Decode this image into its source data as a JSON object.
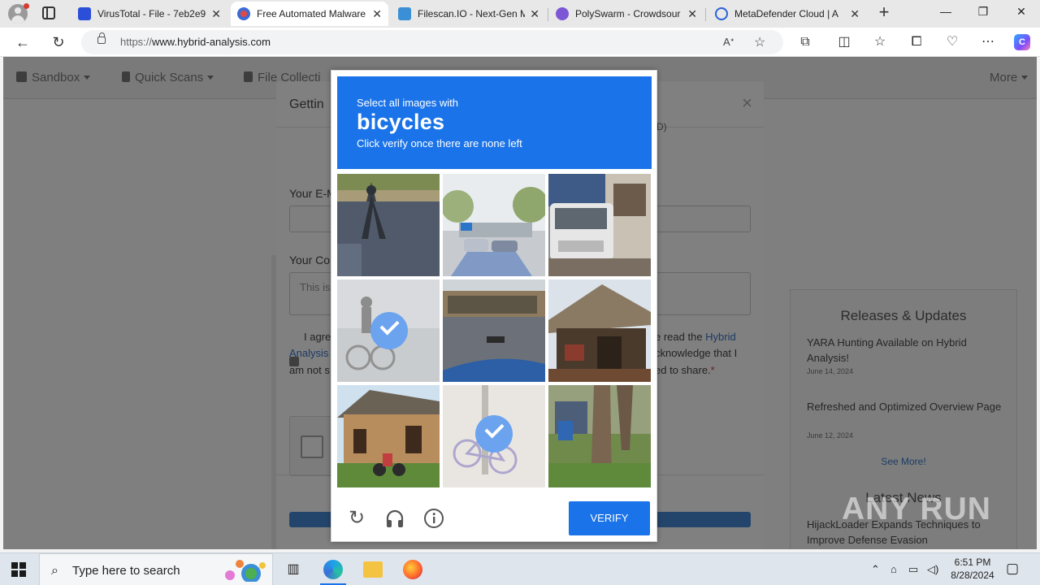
{
  "browser": {
    "tabs": [
      {
        "title": "VirusTotal - File - 7eb2e9",
        "active": false,
        "favicon": "virustotal-icon"
      },
      {
        "title": "Free Automated Malware",
        "active": true,
        "favicon": "hybrid-analysis-icon"
      },
      {
        "title": "Filescan.IO - Next-Gen M",
        "active": false,
        "favicon": "filescan-icon"
      },
      {
        "title": "PolySwarm - Crowdsour",
        "active": false,
        "favicon": "polyswarm-icon"
      },
      {
        "title": "MetaDefender Cloud | A",
        "active": false,
        "favicon": "metadefender-icon"
      }
    ],
    "url": {
      "protocol": "https://",
      "host": "www.hybrid-analysis.com"
    },
    "window_controls": [
      "minimize",
      "restore",
      "close"
    ]
  },
  "site_nav": {
    "items": [
      {
        "label": "Sandbox",
        "icon": "cube-icon"
      },
      {
        "label": "Quick Scans",
        "icon": "file-icon"
      },
      {
        "label": "File Collecti",
        "icon": "copy-icon"
      }
    ],
    "more": "More"
  },
  "modal": {
    "title": "Gettin",
    "email_label": "Your E-M",
    "comment_label": "Your Co",
    "comment_placeholder": "This is",
    "hint_tail": "(D)",
    "consent_left": [
      "I agre",
      "Analysis",
      "am not s"
    ],
    "consent_right": [
      "e read the ",
      "cknowledge that I",
      "ed to share."
    ],
    "consent_link": "Hybrid",
    "required_mark": "*"
  },
  "captcha": {
    "prompt": "Select all images with",
    "object": "bicycles",
    "instruction": "Click verify once there are none left",
    "tiles": [
      {
        "subject": "shadow-on-pavement",
        "selected": false
      },
      {
        "subject": "parking-lot-with-cars",
        "selected": false
      },
      {
        "subject": "white-truck",
        "selected": false
      },
      {
        "subject": "cyclist-on-road",
        "selected": true
      },
      {
        "subject": "blue-car-hood",
        "selected": false
      },
      {
        "subject": "open-shelter",
        "selected": false
      },
      {
        "subject": "mud-house-with-motorbike",
        "selected": false
      },
      {
        "subject": "parked-bicycle",
        "selected": true
      },
      {
        "subject": "tree-trunk",
        "selected": false
      }
    ],
    "verify_label": "VERIFY",
    "footer_icons": [
      "refresh-icon",
      "headphones-icon",
      "info-icon"
    ],
    "accent": "#1a73e8"
  },
  "sidebar": {
    "releases_title": "Releases & Updates",
    "releases": [
      {
        "title": "YARA Hunting Available on Hybrid Analysis!",
        "date": "June 14, 2024"
      },
      {
        "title": "Refreshed and Optimized Overview Page",
        "date": "June 12, 2024"
      }
    ],
    "see_more": "See More!",
    "news_title": "Latest News",
    "news": [
      {
        "title": "HijackLoader Expands Techniques to Improve Defense Evasion"
      }
    ]
  },
  "watermark": "ANY RUN",
  "taskbar": {
    "search_placeholder": "Type here to search",
    "time": "6:51 PM",
    "date": "8/28/2024"
  }
}
